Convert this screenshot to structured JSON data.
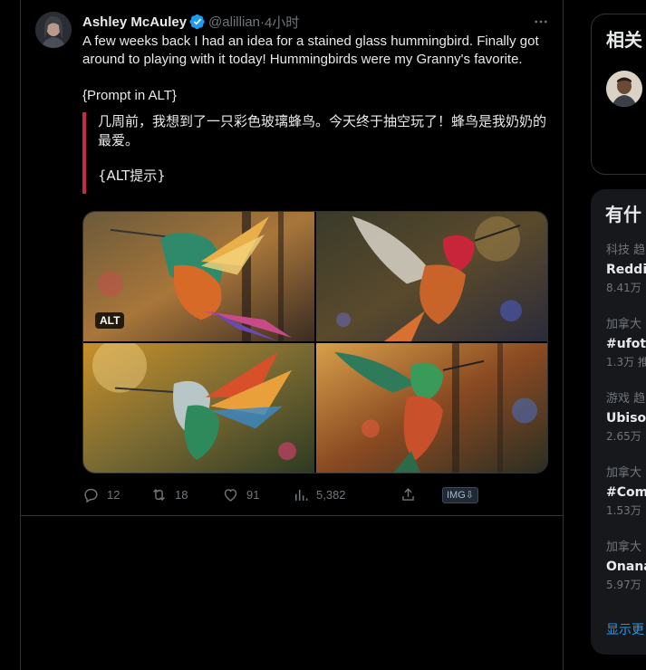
{
  "tweet": {
    "author_name": "Ashley McAuley",
    "handle": "@alillian",
    "separator": " · ",
    "time": "4小时",
    "text_line1": "A few weeks back I had an idea for a stained glass hummingbird. Finally got around to playing with it today! Hummingbirds were my Granny's favorite.",
    "text_line2": "{Prompt in ALT}",
    "translation_line1": "几周前，我想到了一只彩色玻璃蜂鸟。今天终于抽空玩了！蜂鸟是我奶奶的最爱。",
    "translation_line2": "{ALT提示}",
    "alt_badge": "ALT",
    "more_icon": "more-horizontal-icon",
    "actions": {
      "replies": "12",
      "retweets": "18",
      "likes": "91",
      "views": "5,382"
    },
    "img_button": "IMG⇩"
  },
  "sidebar": {
    "related_title": "相关",
    "trends_title": "有什",
    "trends": [
      {
        "category": "科技 趋",
        "name": "Reddit",
        "count": "8.41万"
      },
      {
        "category": "加拿大",
        "name": "#ufotw",
        "count": "1.3万 推"
      },
      {
        "category": "游戏 趋",
        "name": "Ubisof",
        "count": "2.65万"
      },
      {
        "category": "加拿大",
        "name": "#Com",
        "count": "1.53万"
      },
      {
        "category": "加拿大",
        "name": "Onana",
        "count": "5.97万"
      }
    ],
    "show_more": "显示更"
  },
  "colors": {
    "accent": "#1d9bf0",
    "quote_bar": "#c42a4a",
    "muted": "#71767b",
    "border": "#2f3336"
  }
}
